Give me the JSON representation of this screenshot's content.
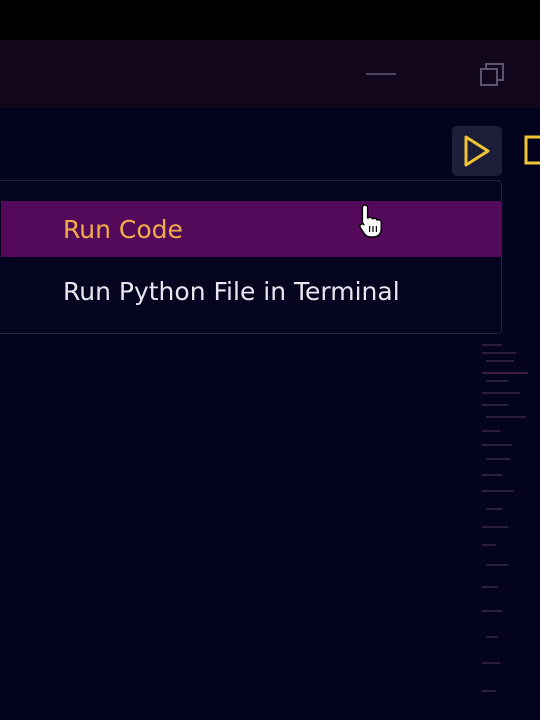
{
  "window": {
    "controls": [
      "minimize",
      "restore"
    ]
  },
  "toolbar": {
    "run_icon": "play-icon",
    "layout_icon": "split-editor-icon"
  },
  "context_menu": {
    "items": [
      {
        "label": "Run Code",
        "highlighted": true
      },
      {
        "label": "Run Python File in Terminal",
        "highlighted": false
      }
    ]
  },
  "colors": {
    "background": "#03031f",
    "titlebar": "#12061c",
    "highlight": "#530a5b",
    "highlight_text": "#f2ad4b",
    "menu_text": "#e8e6ef",
    "icon_accent": "#f0c432"
  }
}
